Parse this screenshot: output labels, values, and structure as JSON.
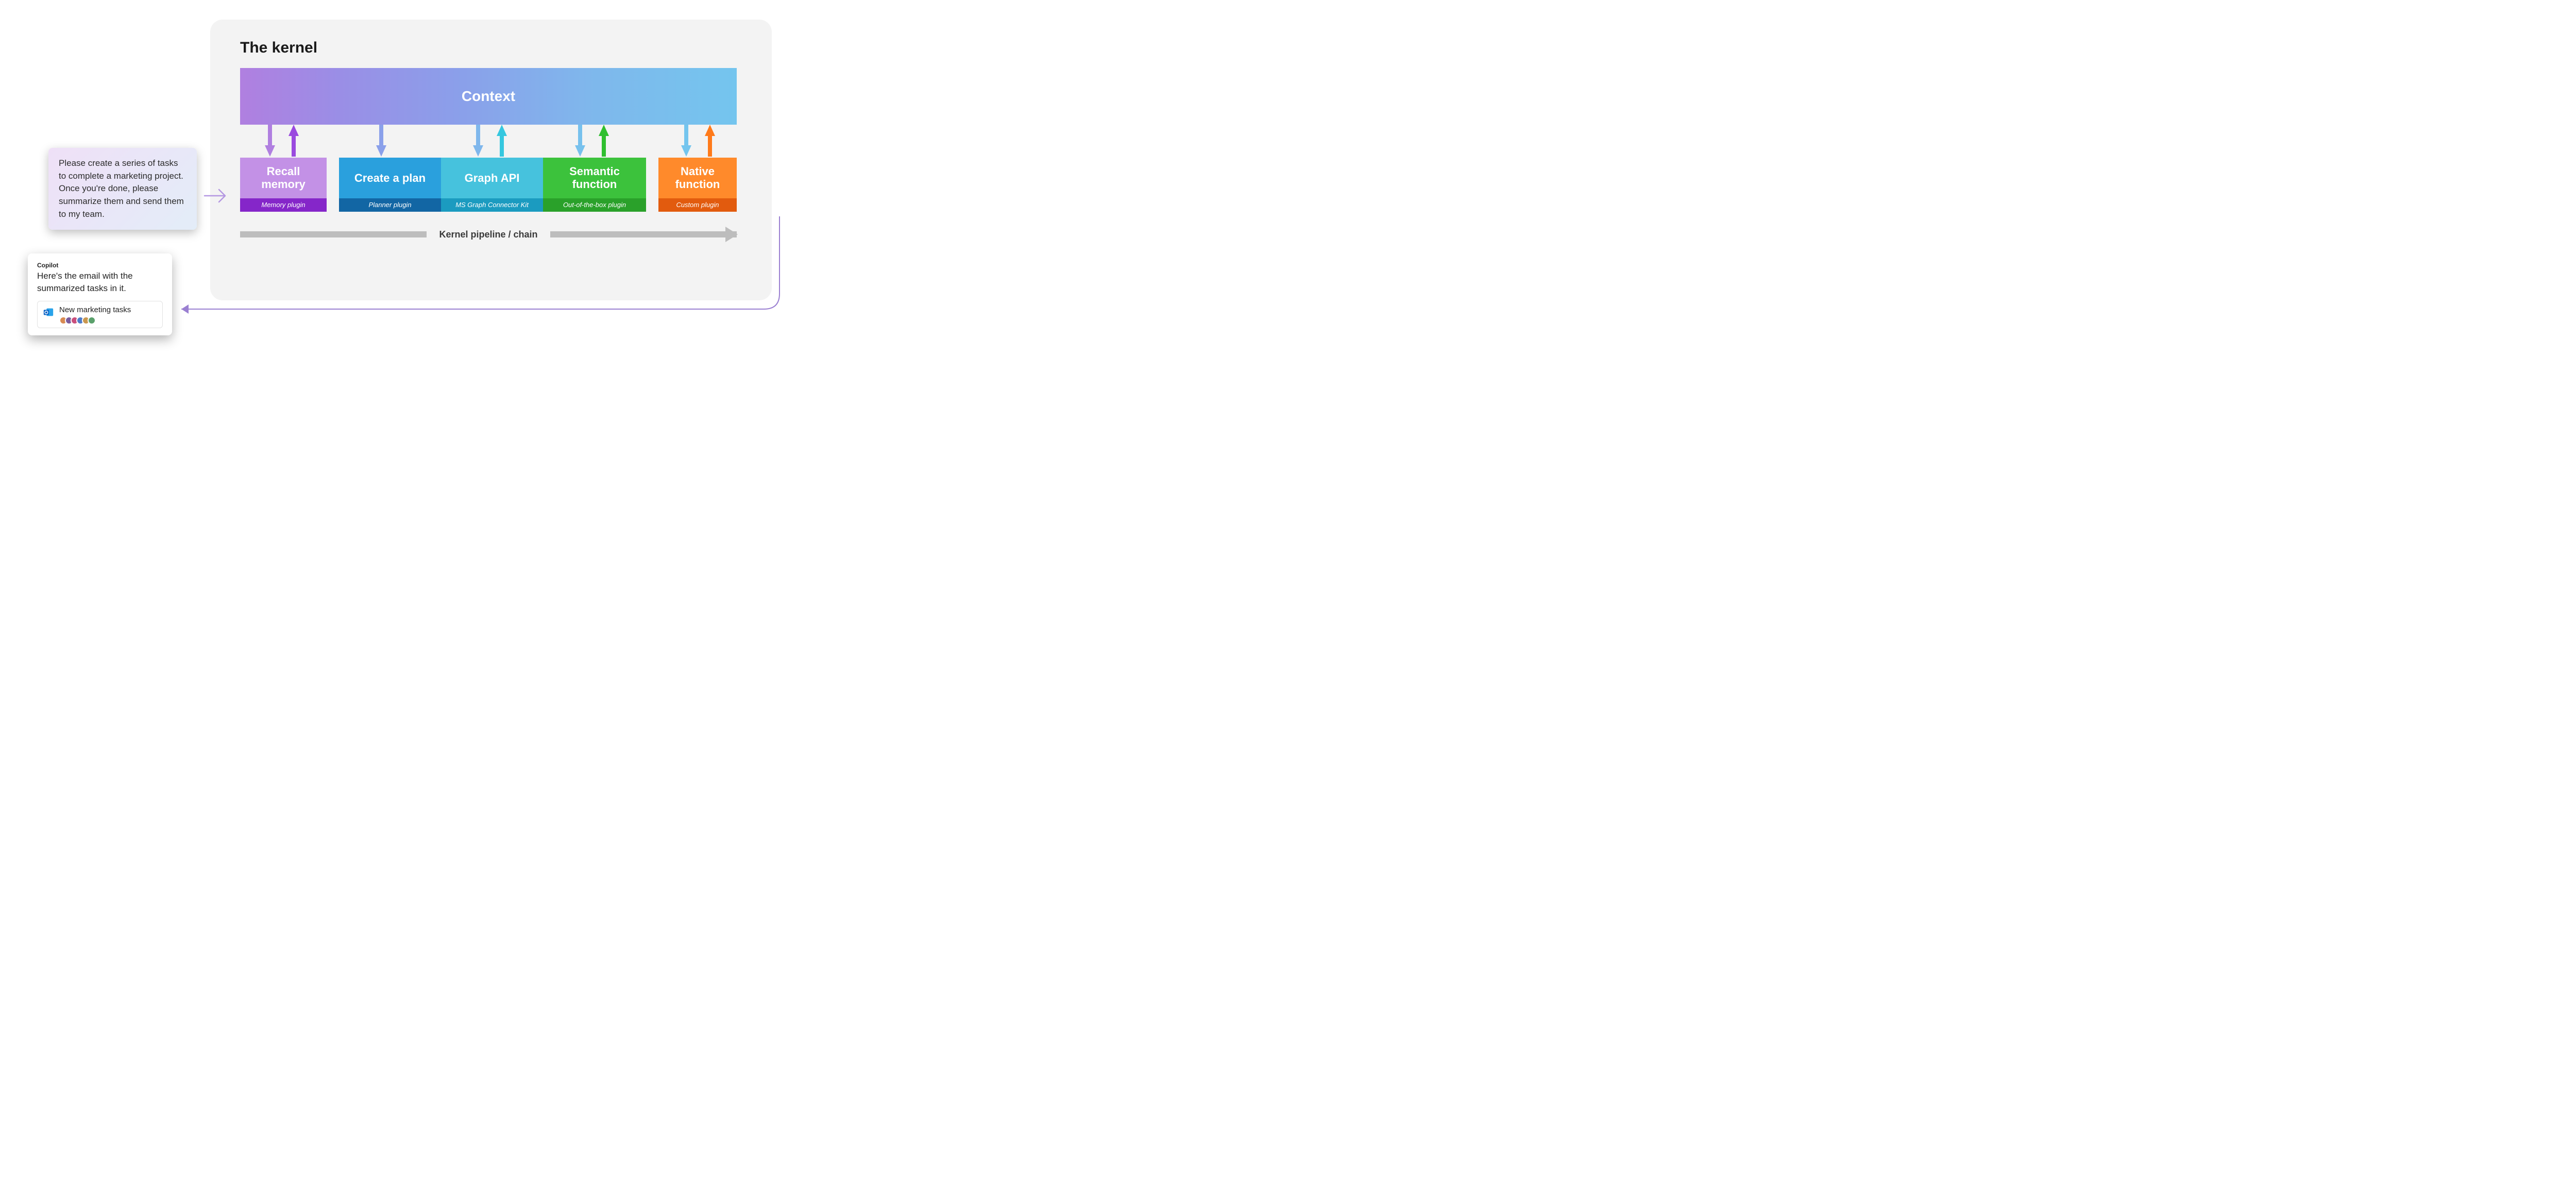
{
  "kernel": {
    "title": "The kernel",
    "context_label": "Context",
    "pipeline_label": "Kernel pipeline / chain",
    "plugins": {
      "recall": {
        "title1": "Recall",
        "title2": "memory",
        "sub": "Memory plugin"
      },
      "plan": {
        "title": "Create a plan",
        "sub": "Planner plugin"
      },
      "graph": {
        "title": "Graph API",
        "sub": "MS Graph Connector Kit"
      },
      "semantic": {
        "title1": "Semantic",
        "title2": "function",
        "sub": "Out-of-the-box plugin"
      },
      "native": {
        "title1": "Native",
        "title2": "function",
        "sub": "Custom plugin"
      }
    }
  },
  "prompt": {
    "text": "Please create a series of tasks to complete a marketing project. Once you're done, please summarize them and send them to my team."
  },
  "copilot": {
    "label": "Copilot",
    "body": "Here's the email with the summarized tasks in it.",
    "email_title": "New marketing tasks"
  },
  "colors": {
    "recall_down": "#b07fe0",
    "recall_up": "#9a4adf",
    "plan_down": "#8aa0ea",
    "graph_down": "#7fb7ec",
    "graph_up": "#35c7df",
    "sem_down": "#77c1ed",
    "sem_up": "#2fbf2f",
    "native_down": "#74c5ee",
    "native_up": "#ff7a1a"
  }
}
